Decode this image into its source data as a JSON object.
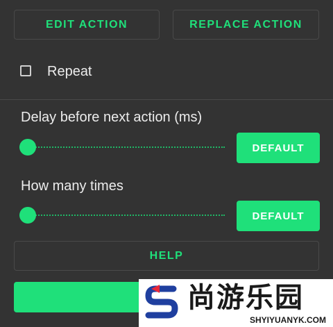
{
  "top_buttons": {
    "edit_action": "EDIT ACTION",
    "replace_action": "REPLACE ACTION"
  },
  "repeat": {
    "label": "Repeat",
    "checked": false
  },
  "delay": {
    "label": "Delay before next action (ms)",
    "slider_value": 0.0,
    "default_label": "DEFAULT"
  },
  "times": {
    "label": "How many times",
    "slider_value": 0.0,
    "default_label": "DEFAULT"
  },
  "help_label": "HELP",
  "watermark": {
    "text": "尚游乐园",
    "url": "SHYIYUANYK.COM"
  },
  "colors": {
    "accent": "#1fe07a",
    "background": "#333333",
    "text": "#ececec"
  }
}
